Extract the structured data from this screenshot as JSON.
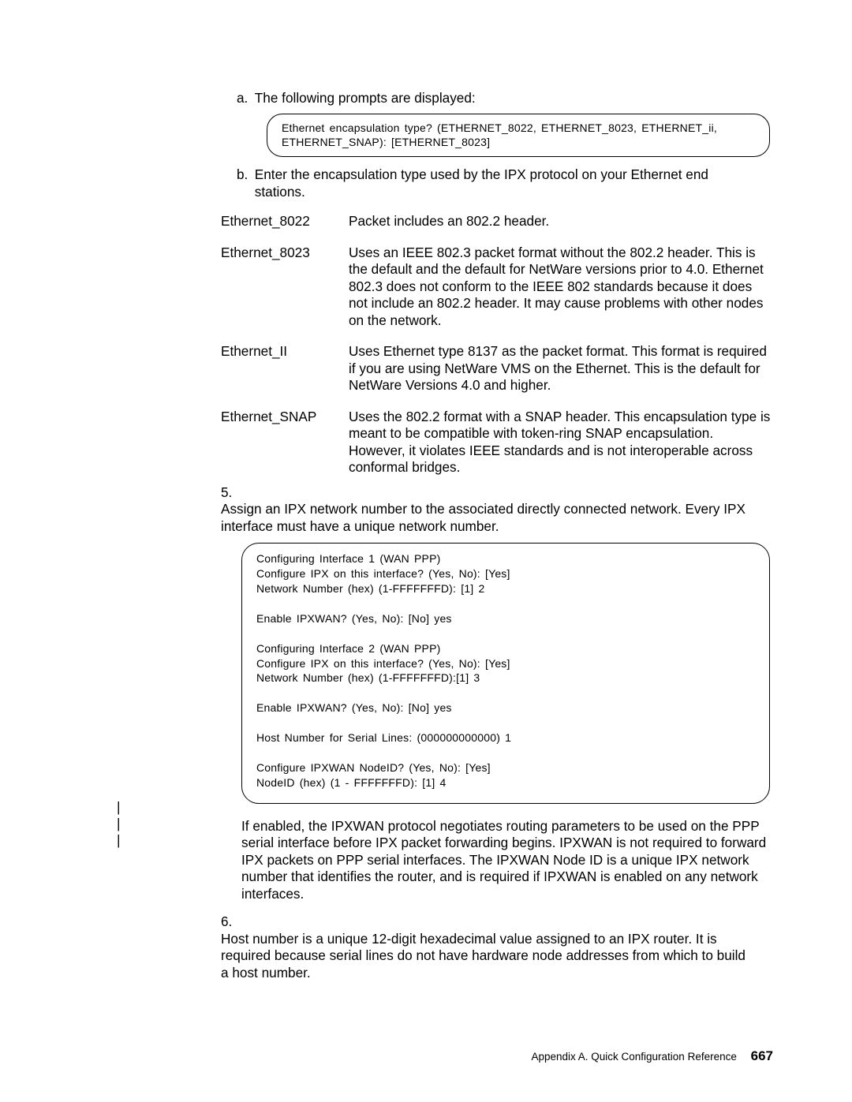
{
  "steps": {
    "a_marker": "a.",
    "a_text": "The following prompts are displayed:",
    "term1_l1": "Ethernet encapsulation type? (ETHERNET_8022, ETHERNET_8023, ETHERNET_ii,",
    "term1_l2": "ETHERNET_SNAP): [ETHERNET_8023]",
    "b_marker": "b.",
    "b_text": "Enter the encapsulation type used by the IPX protocol on your Ethernet end stations."
  },
  "defs": [
    {
      "term": "Ethernet_8022",
      "desc": "Packet includes an 802.2 header."
    },
    {
      "term": "Ethernet_8023",
      "desc": "Uses an IEEE 802.3 packet format without the 802.2 header. This is the default and the default for NetWare versions prior to 4.0. Ethernet 802.3 does not conform to the IEEE 802 standards because it does not include an 802.2 header. It may cause problems with other nodes on the network."
    },
    {
      "term": "Ethernet_II",
      "desc": "Uses Ethernet type 8137 as the packet format. This format is required if you are using NetWare VMS on the Ethernet. This is the default for NetWare Versions 4.0 and higher."
    },
    {
      "term": "Ethernet_SNAP",
      "desc": "Uses the 802.2 format with a SNAP header. This encapsulation type is meant to be compatible with token-ring SNAP encapsulation. However, it violates IEEE standards and is not interoperable across conformal bridges."
    }
  ],
  "num5_marker": "5.",
  "num5_text": "Assign an IPX network number to the associated directly connected network. Every IPX interface must have a unique network number.",
  "term2": "Configuring Interface 1 (WAN PPP)\nConfigure IPX on this interface? (Yes, No): [Yes]\nNetwork Number (hex) (1-FFFFFFFD): [1] 2\n\nEnable IPXWAN? (Yes, No): [No] yes\n\nConfiguring Interface 2 (WAN PPP)\nConfigure IPX on this interface? (Yes, No): [Yes]\nNetwork Number (hex) (1-FFFFFFFD):[1] 3\n\nEnable IPXWAN? (Yes, No): [No] yes\n\nHost Number for Serial Lines: (000000000000) 1\n\nConfigure IPXWAN NodeID? (Yes, No): [Yes]\nNodeID (hex) (1 - FFFFFFFD): [1] 4",
  "para_after_term2": "If enabled, the IPXWAN protocol negotiates routing parameters to be used on the PPP serial interface before IPX packet forwarding begins. IPXWAN is not required to forward IPX packets on PPP serial interfaces. The IPXWAN Node ID is a unique IPX network number that identifies the router, and is required if IPXWAN is enabled on any network interfaces.",
  "num6_marker": "6.",
  "num6_text": "Host number is a unique 12-digit hexadecimal value assigned to an IPX router. It is required because serial lines do not have hardware node addresses from which to build a host number.",
  "footer_label": "Appendix A. Quick Configuration Reference",
  "footer_page": "667",
  "bar": "|"
}
